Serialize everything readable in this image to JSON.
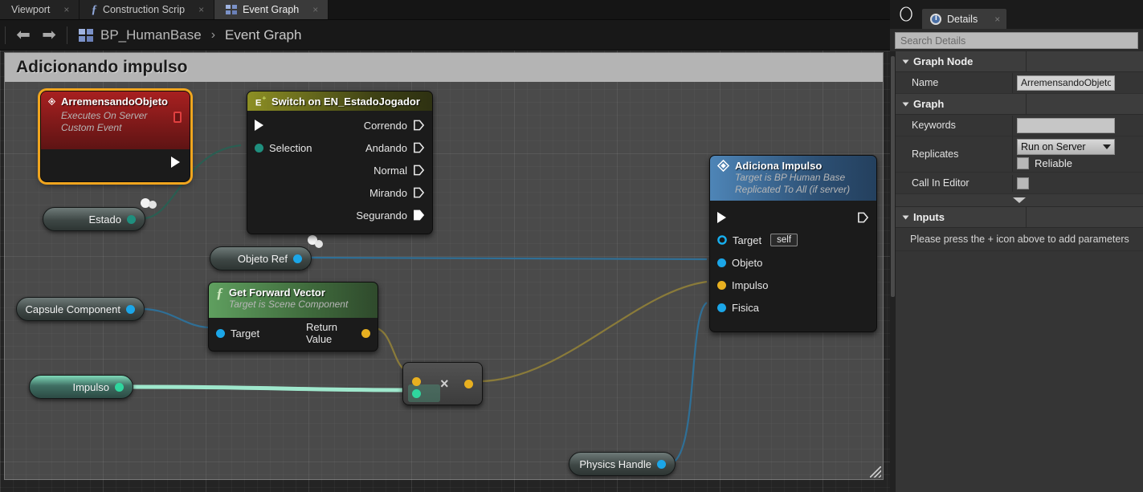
{
  "tabs": [
    {
      "label": "Viewport",
      "icon": "none",
      "active": false,
      "close": "×"
    },
    {
      "label": "Construction Scrip",
      "icon": "function-icon",
      "active": false,
      "close": "×"
    },
    {
      "label": "Event Graph",
      "icon": "grid-icon",
      "active": true,
      "close": "×"
    }
  ],
  "toolbar": {
    "back_icon": "⬅",
    "forward_icon": "➡",
    "graph_icon": "grid-icon",
    "breadcrumb_root": "BP_HumanBase",
    "breadcrumb_sep": "›",
    "breadcrumb_current": "Event Graph"
  },
  "graph": {
    "comment_title": "Adicionando impulso",
    "nodes": {
      "event": {
        "title": "ArremensandoObjeto",
        "subtitle_line1": "Executes On Server",
        "subtitle_line2": "Custom Event",
        "selected": true
      },
      "switch": {
        "title": "Switch on EN_EstadoJogador",
        "input_pin": "Selection",
        "outputs": [
          "Correndo",
          "Andando",
          "Normal",
          "Mirando",
          "Segurando"
        ]
      },
      "forward_vector": {
        "title": "Get Forward Vector",
        "subtitle": "Target is Scene Component",
        "input_pin": "Target",
        "output_pin": "Return Value"
      },
      "adiciona_impulso": {
        "title": "Adiciona Impulso",
        "subtitle_line1": "Target is BP Human Base",
        "subtitle_line2": "Replicated To All (if server)",
        "pins": [
          {
            "label": "Target",
            "value": "self",
            "color": "#17b0f0",
            "hollow": true
          },
          {
            "label": "Objeto",
            "value": "",
            "color": "#1ba6e8",
            "hollow": false
          },
          {
            "label": "Impulso",
            "value": "",
            "color": "#e8b020",
            "hollow": false
          },
          {
            "label": "Fisica",
            "value": "",
            "color": "#1ba6e8",
            "hollow": false
          }
        ]
      },
      "multiply": {
        "symbol": "×"
      }
    },
    "variables": [
      {
        "name": "Estado",
        "pin_color": "#1f8f7e",
        "highlight": false
      },
      {
        "name": "Objeto Ref",
        "pin_color": "#1ba6e8",
        "highlight": false
      },
      {
        "name": "Capsule Component",
        "pin_color": "#1ba6e8",
        "highlight": false
      },
      {
        "name": "Impulso",
        "pin_color": "#2fd69e",
        "highlight": true
      },
      {
        "name": "Physics Handle",
        "pin_color": "#1ba6e8",
        "highlight": false
      }
    ]
  },
  "details": {
    "panel_tab": "Details",
    "panel_tab_icon": "info-search-icon",
    "panel_tab_close": "×",
    "search_placeholder": "Search Details",
    "search_value": "",
    "sections": [
      {
        "title": "Graph Node",
        "rows": [
          {
            "label": "Name",
            "type": "text",
            "value": "ArremensandoObjeto"
          }
        ]
      },
      {
        "title": "Graph",
        "rows": [
          {
            "label": "Keywords",
            "type": "text",
            "value": ""
          },
          {
            "label": "Replicates",
            "type": "dropdown",
            "value": "Run on Server",
            "checkbox_label": "Reliable",
            "checkbox_checked": false
          },
          {
            "label": "Call In Editor",
            "type": "checkbox",
            "value": "",
            "checkbox_checked": false
          }
        ]
      },
      {
        "title": "Inputs",
        "hint": "Please press the + icon above to add parameters",
        "rows": []
      }
    ]
  },
  "colors": {
    "accent_orange": "#f0a51e",
    "exec_white": "#ffffff",
    "event_red": "#a82020",
    "switch_olive": "#8d8f24",
    "func_green": "#5f9f5f",
    "call_blue": "#4e85b7",
    "pin_object": "#1ba6e8",
    "pin_float": "#e8b020",
    "pin_enum": "#1f8f7e",
    "pin_vector": "#2fd69e"
  }
}
